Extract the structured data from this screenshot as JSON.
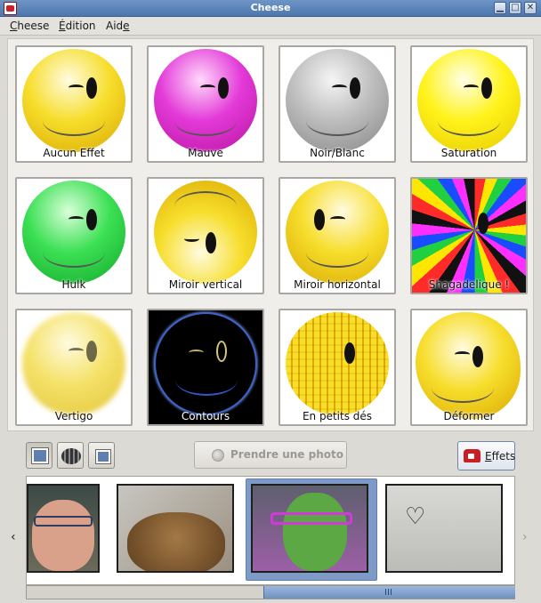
{
  "window": {
    "title": "Cheese",
    "buttons": [
      "minimize",
      "maximize",
      "close"
    ]
  },
  "menu": [
    {
      "label": "Cheese",
      "mnemonic": "C",
      "rest": "heese"
    },
    {
      "label": "Édition",
      "mnemonic": "É",
      "rest": "dition"
    },
    {
      "label": "Aide",
      "mnemonic": "Aid",
      "rest": "e",
      "underline_last": true
    }
  ],
  "effects": [
    {
      "label": "Aucun Effet",
      "color": "#f2d21f"
    },
    {
      "label": "Mauve",
      "color": "#e021d6"
    },
    {
      "label": "Noir/Blanc",
      "color": "#b5b5b5"
    },
    {
      "label": "Saturation",
      "color": "#ffef1a"
    },
    {
      "label": "Hulk",
      "color": "#2ee04a"
    },
    {
      "label": "Miroir vertical",
      "color": "#f0d21f"
    },
    {
      "label": "Miroir horizontal",
      "color": "#f0d21f"
    },
    {
      "label": "Shagadelique !",
      "color": "#multicolor"
    },
    {
      "label": "Vertigo",
      "color": "#f2de63"
    },
    {
      "label": "Contours",
      "color": "#000000"
    },
    {
      "label": "En petits dés",
      "color": "#f4df3c"
    },
    {
      "label": "Déformer",
      "color": "#f0d21f"
    }
  ],
  "toolbar": {
    "mode_photo_icon": "photo-mode-icon",
    "mode_video_icon": "film-reel-icon",
    "mode_burst_icon": "burst-mode-icon",
    "take_photo_label": "Prendre une photo",
    "effects_label_mnemonic": "E",
    "effects_label_rest": "ffets",
    "effects_icon": "red-phone-icon"
  },
  "thumbnails": [
    {
      "name": "thumbnail-man-glasses",
      "selected": false
    },
    {
      "name": "thumbnail-cat",
      "selected": false
    },
    {
      "name": "thumbnail-man-green-effect",
      "selected": true
    },
    {
      "name": "thumbnail-vuntz-sign",
      "selected": false
    }
  ],
  "scroll": {
    "position": 0.5,
    "visible_fraction": 0.52
  }
}
